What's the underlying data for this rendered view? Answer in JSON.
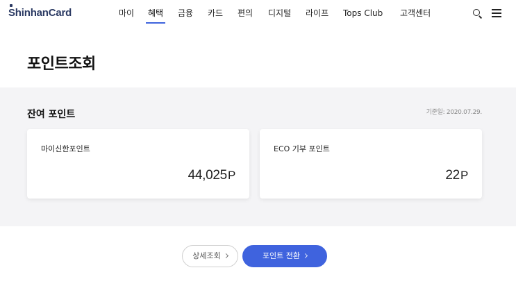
{
  "header": {
    "logo_text": "ShinhanCard",
    "nav": [
      {
        "label": "마이"
      },
      {
        "label": "혜택"
      },
      {
        "label": "금융"
      },
      {
        "label": "카드"
      },
      {
        "label": "편의"
      },
      {
        "label": "디지털"
      },
      {
        "label": "라이프"
      },
      {
        "label": "Tops Club"
      },
      {
        "label": "고객센터"
      }
    ],
    "active_nav": "혜택",
    "icons": [
      "search-icon",
      "menu-icon"
    ]
  },
  "page": {
    "title": "포인트조회"
  },
  "balance": {
    "section_title": "잔여 포인트",
    "base_date": "기준일: 2020.07.29.",
    "cards": [
      {
        "label": "마이신한포인트",
        "value": "44,025",
        "unit": "P"
      },
      {
        "label": "ECO 기부 포인트",
        "value": "22",
        "unit": "P"
      }
    ]
  },
  "actions": {
    "detail_label": "상세조회",
    "convert_label": "포인트 전환"
  },
  "colors": {
    "accent": "#3f63de",
    "brand": "#2b3a63",
    "section_bg": "#f4f4f6"
  }
}
